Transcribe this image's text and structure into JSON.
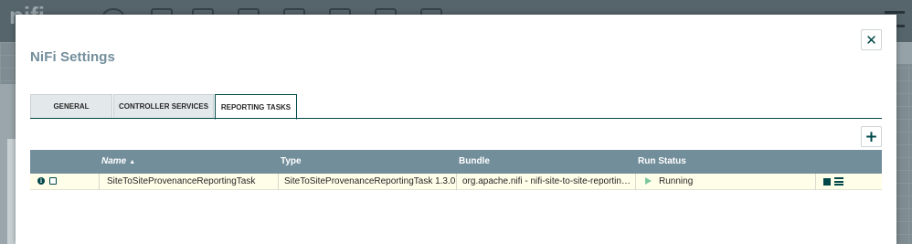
{
  "background": {
    "logo_text": "nifi"
  },
  "dialog": {
    "title": "NiFi Settings",
    "close_icon": "close-icon"
  },
  "tabs": [
    {
      "label": "GENERAL",
      "active": false
    },
    {
      "label": "CONTROLLER SERVICES",
      "active": false
    },
    {
      "label": "REPORTING TASKS",
      "active": true
    }
  ],
  "add_button_icon": "plus-icon",
  "table": {
    "columns": [
      "Name",
      "Type",
      "Bundle",
      "Run Status"
    ],
    "sort_indicator": "▲",
    "rows": [
      {
        "name": "SiteToSiteProvenanceReportingTask",
        "type": "SiteToSiteProvenanceReportingTask 1.3.0",
        "bundle": "org.apache.nifi - nifi-site-to-site-reporting-nar",
        "run_status": "Running",
        "info_icon": "info-icon",
        "usage_icon": "book-icon",
        "status_icon": "play-icon",
        "action_icons": [
          "stop-icon",
          "view-state-icon"
        ]
      }
    ]
  },
  "colors": {
    "accent": "#004849",
    "header": "#728e9b",
    "row_highlight": "#fffee8",
    "running": "#7dc7a0"
  }
}
